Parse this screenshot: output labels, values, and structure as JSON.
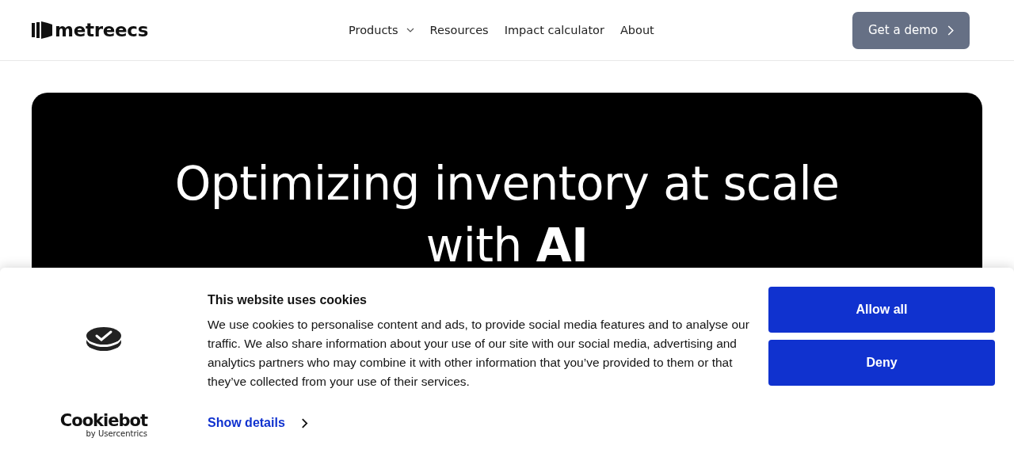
{
  "header": {
    "logo": "metreecs",
    "nav": [
      {
        "label": "Products",
        "has_menu": true
      },
      {
        "label": "Resources",
        "has_menu": false
      },
      {
        "label": "Impact calculator",
        "has_menu": false
      },
      {
        "label": "About",
        "has_menu": false
      }
    ],
    "cta": "Get a demo"
  },
  "hero": {
    "heading": "Optimizing inventory at scale with **AI**"
  },
  "cookie_banner": {
    "brand": "Cookiebot",
    "brand_sub": "by Usercentrics",
    "title": "This website uses cookies",
    "body": "We use cookies to personalise content and ads, to provide social media features and to analyse our traffic. We also share information about your use of our site with our social media, advertising and analytics partners who may combine it with other information that you’ve provided to them or that they’ve collected from your use of their services.",
    "details_link": "Show details",
    "buttons": [
      {
        "label": "Allow all"
      },
      {
        "label": "Deny"
      }
    ]
  }
}
